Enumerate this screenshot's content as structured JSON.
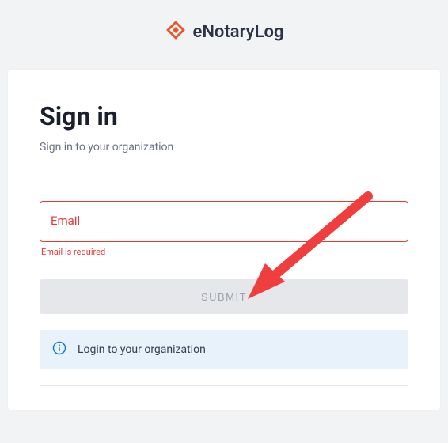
{
  "brand": {
    "name": "eNotaryLog"
  },
  "card": {
    "title": "Sign in",
    "subtitle": "Sign in to your organization",
    "email_label": "Email",
    "email_error": "Email is required",
    "submit_label": "SUBMIT",
    "info_text": "Login to your organization"
  }
}
